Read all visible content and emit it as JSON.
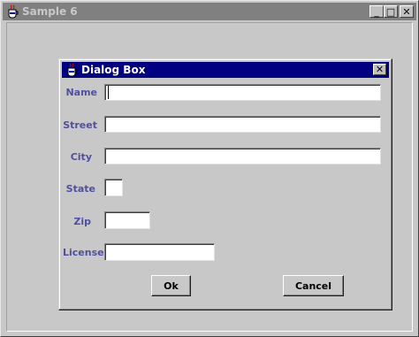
{
  "window": {
    "title": "Sample 6",
    "minimize": "_",
    "maximize": "□",
    "close": "✕"
  },
  "dialog": {
    "title": "Dialog Box",
    "close": "✕"
  },
  "form": {
    "name_label": "Name",
    "street_label": "Street",
    "city_label": "City",
    "state_label": "State",
    "zip_label": "Zip",
    "license_label": "License",
    "name_value": "",
    "street_value": "",
    "city_value": "",
    "state_value": "",
    "zip_value": "",
    "license_value": ""
  },
  "buttons": {
    "ok": "Ok",
    "cancel": "Cancel"
  },
  "colors": {
    "active_title": "#000080",
    "inactive_title": "#808080",
    "label": "#5050a0"
  }
}
